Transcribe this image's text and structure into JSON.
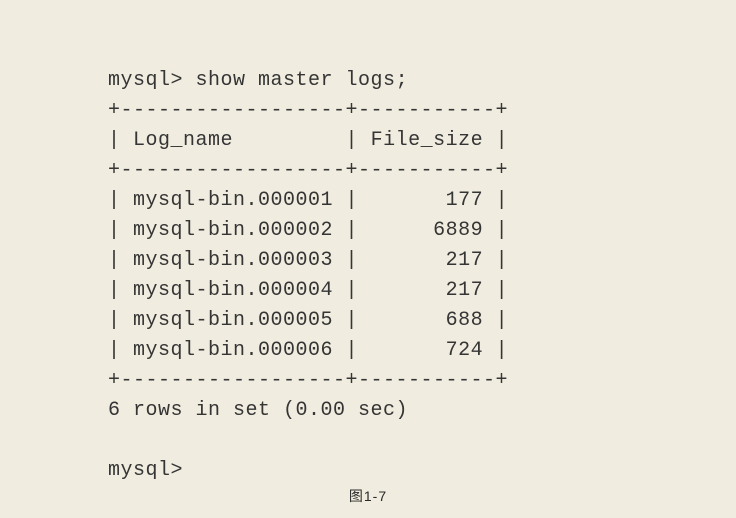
{
  "terminal": {
    "prompt": "mysql>",
    "command": "show master logs;",
    "headers": [
      "Log_name",
      "File_size"
    ],
    "rows": [
      {
        "log_name": "mysql-bin.000001",
        "file_size": "177"
      },
      {
        "log_name": "mysql-bin.000002",
        "file_size": "6889"
      },
      {
        "log_name": "mysql-bin.000003",
        "file_size": "217"
      },
      {
        "log_name": "mysql-bin.000004",
        "file_size": "217"
      },
      {
        "log_name": "mysql-bin.000005",
        "file_size": "688"
      },
      {
        "log_name": "mysql-bin.000006",
        "file_size": "724"
      }
    ],
    "summary": "6 rows in set (0.00 sec)"
  },
  "caption": "图1-7"
}
